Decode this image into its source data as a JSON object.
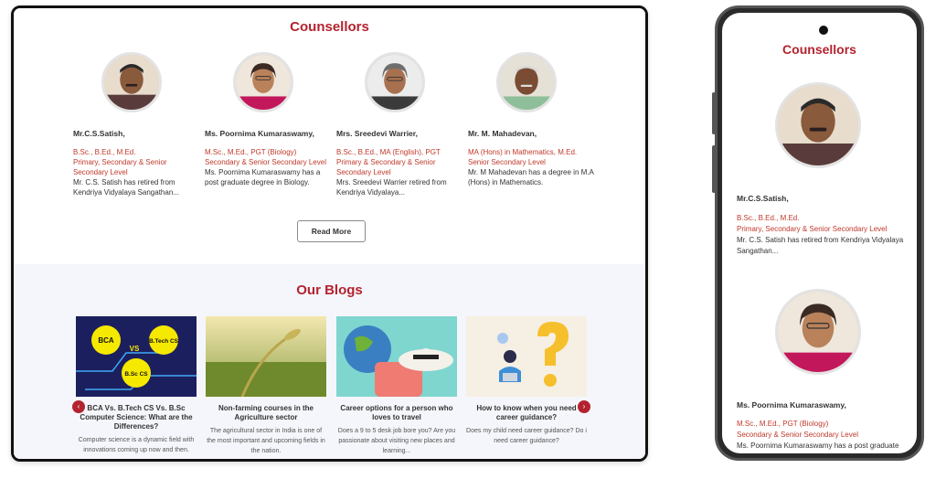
{
  "desktop": {
    "counsellors_title": "Counsellors",
    "counsellors": [
      {
        "name": "Mr.C.S.Satish,",
        "qual1": "B.Sc., B.Ed., M.Ed.",
        "qual2": "Primary, Secondary & Senior Secondary Level",
        "desc": "Mr. C.S. Satish has retired from Kendriya Vidyalaya Sangathan..."
      },
      {
        "name": "Ms. Poornima Kumaraswamy,",
        "qual1": "M.Sc., M.Ed., PGT (Biology)",
        "qual2": "Secondary & Senior Secondary Level",
        "desc": "Ms. Poornima Kumaraswamy has a post graduate degree in Biology."
      },
      {
        "name": "Mrs. Sreedevi Warrier,",
        "qual1": "B.Sc., B.Ed., MA (English), PGT",
        "qual2": "Primary & Secondary & Senior Secondary Level",
        "desc": "Mrs. Sreedevi Warrier retired from Kendriya Vidyalaya..."
      },
      {
        "name": "Mr. M. Mahadevan,",
        "qual1": "MA (Hons) in Mathematics, M.Ed.",
        "qual2": "Senior Secondary Level",
        "desc": "Mr. M Mahadevan has a degree in M.A (Hons) in Mathematics."
      }
    ],
    "read_more": "Read More",
    "blogs_title": "Our Blogs",
    "blogs": [
      {
        "title": "BCA Vs. B.Tech CS Vs. B.Sc Computer Science: What are the Differences?",
        "text": "Computer science is a dynamic field with innovations coming up now and then.",
        "img_labels": [
          "BCA",
          "VS",
          "B.Tech CS",
          "B.Sc CS"
        ]
      },
      {
        "title": "Non-farming courses in the Agriculture sector",
        "text": "The agricultural sector in India is one of the most important and upcoming fields in the nation."
      },
      {
        "title": "Career options for a person who loves to travel",
        "text": "Does a 9 to 5 desk job bore you? Are you passionate about visiting new places and learning..."
      },
      {
        "title": "How to know when you need career guidance?",
        "text": "Does my child need career guidance? Do i need career guidance?"
      }
    ],
    "prev_arrow": "‹",
    "next_arrow": "›"
  },
  "mobile": {
    "counsellors_title": "Counsellors",
    "counsellors": [
      {
        "name": "Mr.C.S.Satish,",
        "qual1": "B.Sc., B.Ed., M.Ed.",
        "qual2": "Primary, Secondary & Senior Secondary Level",
        "desc": "Mr. C.S. Satish has retired from Kendriya Vidyalaya Sangathan..."
      },
      {
        "name": "Ms. Poornima Kumaraswamy,",
        "qual1": "M.Sc., M.Ed., PGT (Biology)",
        "qual2": "Secondary & Senior Secondary Level",
        "desc": "Ms. Poornima Kumaraswamy has a post graduate degree in Biology."
      }
    ]
  },
  "colors": {
    "accent": "#b3232f",
    "qualification": "#c0392b",
    "blogs_bg": "#f5f6fb"
  }
}
